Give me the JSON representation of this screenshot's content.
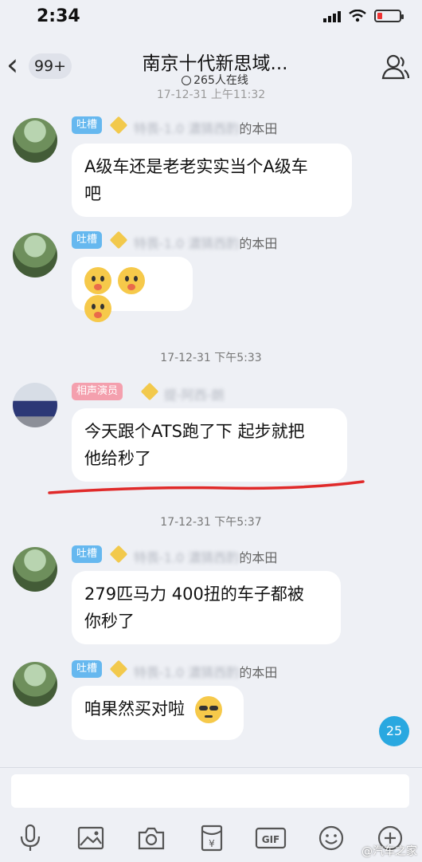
{
  "status": {
    "time": "2:34"
  },
  "header": {
    "back_badge": "99+",
    "title": "南京十代新思域...",
    "online": "265人在线"
  },
  "top_clipped_time": "17-12-31 上午11:32",
  "messages": [
    {
      "tag": "吐槽",
      "name_blurred": "特畏-1.0 濃猜西酌",
      "name_suffix": "的本田",
      "text_lines": [
        "A级车还是老老实实当个A级车",
        "吧"
      ]
    },
    {
      "tag": "吐槽",
      "name_blurred": "特畏-1.0 濃猜西酌",
      "name_suffix": "的本田",
      "emojis": [
        "tongue-face",
        "tongue-face",
        "tongue-face"
      ]
    },
    {
      "timestamp": "17-12-31 下午5:33",
      "tag": "相声演员",
      "name_blurred": "提-阿西-朗",
      "name_suffix": "",
      "text_lines": [
        "今天跟个ATS跑了下 起步就把",
        "他给秒了"
      ]
    },
    {
      "timestamp": "17-12-31 下午5:37",
      "tag": "吐槽",
      "name_blurred": "特畏-1.0 濃猜西酌",
      "name_suffix": "的本田",
      "text_lines": [
        "279匹马力 400扭的车子都被",
        "你秒了"
      ]
    },
    {
      "tag": "吐槽",
      "name_blurred": "特畏-1.0 濃猜西酌",
      "name_suffix": "的本田",
      "text_lines": [
        "咱果然买对啦"
      ],
      "emojis": [
        "sunglasses-face"
      ]
    }
  ],
  "unread_count": "25",
  "toolbar": [
    "mic-icon",
    "image-icon",
    "camera-icon",
    "red-packet-icon",
    "gif-icon",
    "emoji-icon",
    "more-icon"
  ],
  "watermark": "@汽车之家"
}
